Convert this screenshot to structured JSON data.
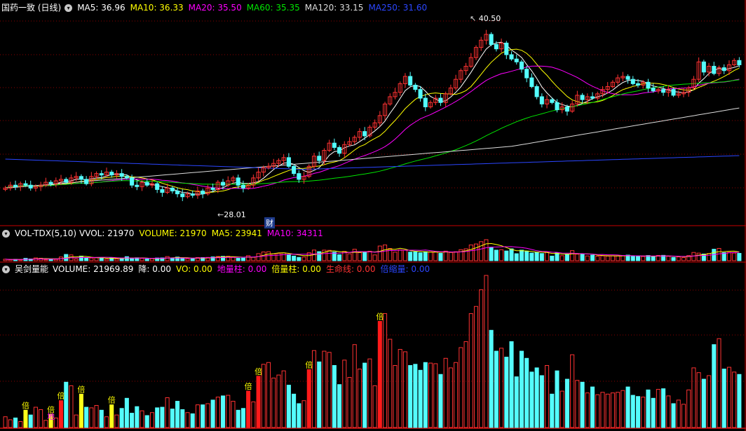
{
  "stock": {
    "title": "国药一致 (日线)"
  },
  "colors": {
    "up": "#ff3232",
    "down": "#54fcfc",
    "grid": "#8b0000",
    "border": "#c80000",
    "ma5": "#ffffff",
    "ma10": "#ffff00",
    "ma20": "#ff00ff",
    "ma60": "#00e600",
    "ma120": "#dcdcdc",
    "ma250": "#2b46ff"
  },
  "main_legend": [
    {
      "text": "MA5: 36.96",
      "color": "#ffffff"
    },
    {
      "text": "MA10: 36.33",
      "color": "#ffff00"
    },
    {
      "text": "MA20: 35.50",
      "color": "#ff00ff"
    },
    {
      "text": "MA60: 35.35",
      "color": "#00e600"
    },
    {
      "text": "MA120: 33.15",
      "color": "#dcdcdc"
    },
    {
      "text": "MA250: 31.60",
      "color": "#2b46ff"
    }
  ],
  "annotations": {
    "high": "40.50",
    "low": "28.01",
    "fin": "财"
  },
  "vol_panel": {
    "name": "VOL-TDX(5,10)",
    "items": [
      {
        "text": "VVOL: 21970",
        "color": "#ffffff"
      },
      {
        "text": "VOLUME: 21970",
        "color": "#ffff00"
      },
      {
        "text": "MA5: 23941",
        "color": "#ffff00"
      },
      {
        "text": "MA10: 34311",
        "color": "#ff00ff"
      }
    ]
  },
  "ind_panel": {
    "name": "吴剑量能",
    "items": [
      {
        "text": "VOLUME: 21969.89",
        "color": "#ffffff"
      },
      {
        "text": "降: 0.00",
        "color": "#ffffff"
      },
      {
        "text": "VO: 0.00",
        "color": "#ffff00"
      },
      {
        "text": "地量柱: 0.00",
        "color": "#ff00ff"
      },
      {
        "text": "倍量柱: 0.00",
        "color": "#ffff00"
      },
      {
        "text": "生命线: 0.00",
        "color": "#ff3232"
      },
      {
        "text": "倍缩量: 0.00",
        "color": "#2b46ff"
      }
    ],
    "bei_label": "倍",
    "di_label": "地"
  },
  "chart_data": {
    "type": "candlestick",
    "price_ylim": [
      27,
      41.5
    ],
    "close": [
      29.4,
      29.6,
      29.5,
      29.7,
      29.6,
      29.4,
      29.5,
      29.6,
      29.8,
      29.7,
      29.9,
      30.0,
      29.8,
      30.1,
      30.2,
      30.0,
      29.7,
      30.2,
      30.4,
      30.3,
      30.5,
      30.3,
      30.4,
      30.2,
      30.1,
      29.6,
      29.5,
      29.8,
      29.6,
      29.7,
      29.3,
      29.1,
      29.4,
      29.2,
      29.0,
      28.8,
      29.0,
      28.9,
      29.2,
      29.0,
      29.4,
      29.3,
      29.8,
      29.6,
      29.9,
      30.1,
      29.6,
      29.4,
      29.6,
      30.1,
      30.5,
      30.8,
      30.9,
      31.1,
      31.3,
      31.5,
      30.9,
      30.4,
      30.0,
      30.2,
      30.9,
      31.6,
      31.3,
      32.0,
      32.5,
      32.2,
      31.8,
      32.4,
      32.6,
      32.9,
      33.3,
      33.0,
      33.6,
      33.9,
      34.4,
      35.2,
      35.7,
      36.0,
      36.6,
      37.1,
      36.5,
      36.2,
      35.6,
      35.0,
      35.3,
      35.6,
      35.3,
      35.9,
      36.3,
      36.9,
      37.5,
      37.8,
      38.4,
      39.1,
      39.6,
      40.0,
      39.3,
      39.0,
      39.4,
      38.6,
      38.3,
      38.1,
      37.6,
      37.0,
      36.4,
      35.7,
      35.2,
      35.5,
      35.3,
      34.8,
      35.0,
      34.7,
      35.2,
      35.8,
      35.5,
      35.7,
      35.6,
      35.9,
      36.2,
      36.4,
      36.7,
      37.0,
      37.1,
      36.9,
      36.6,
      36.5,
      36.7,
      36.3,
      36.1,
      36.2,
      36.0,
      36.2,
      35.8,
      35.9,
      36.0,
      36.3,
      36.9,
      38.1,
      37.4,
      37.8,
      37.3,
      37.7,
      37.5,
      37.9,
      38.2,
      37.9
    ],
    "volume": [
      1.8,
      1.3,
      1.6,
      1.0,
      2.9,
      2.1,
      3.4,
      3.0,
      1.2,
      2.2,
      1.6,
      4.5,
      7.6,
      7.0,
      2.1,
      5.6,
      3.4,
      3.3,
      3.7,
      2.9,
      1.8,
      3.8,
      2.1,
      3.2,
      4.9,
      2.4,
      3.5,
      2.8,
      2.0,
      2.5,
      3.3,
      3.4,
      5.0,
      3.1,
      4.4,
      3.0,
      2.5,
      2.3,
      3.8,
      3.8,
      4.0,
      4.6,
      5.1,
      5.3,
      5.4,
      4.4,
      2.9,
      3.2,
      6.1,
      4.3,
      8.6,
      10.6,
      10.9,
      8.3,
      8.8,
      9.5,
      7.1,
      5.6,
      4.0,
      4.5,
      9.7,
      12.9,
      11.0,
      12.8,
      12.6,
      10.4,
      7.2,
      11.3,
      8.4,
      13.9,
      9.8,
      10.8,
      11.5,
      7.0,
      17.8,
      19.1,
      14.8,
      10.4,
      13.1,
      12.7,
      10.4,
      10.6,
      9.6,
      10.9,
      10.8,
      10.7,
      8.9,
      11.6,
      10.0,
      10.9,
      13.4,
      14.4,
      19.1,
      20.3,
      23.1,
      25.5,
      16.3,
      12.8,
      13.3,
      11.8,
      14.4,
      8.5,
      12.8,
      11.6,
      9.3,
      10.0,
      8.7,
      10.4,
      5.6,
      9.5,
      6.1,
      8.1,
      12.2,
      7.9,
      7.6,
      5.8,
      6.8,
      5.5,
      5.9,
      5.6,
      5.8,
      5.9,
      6.2,
      6.8,
      5.4,
      5.2,
      5.1,
      6.3,
      4.9,
      6.4,
      6.5,
      5.3,
      4.0,
      4.6,
      3.9,
      6.3,
      10.0,
      9.2,
      8.1,
      8.7,
      13.9,
      14.9,
      9.8,
      10.1,
      9.3,
      8.9
    ]
  }
}
